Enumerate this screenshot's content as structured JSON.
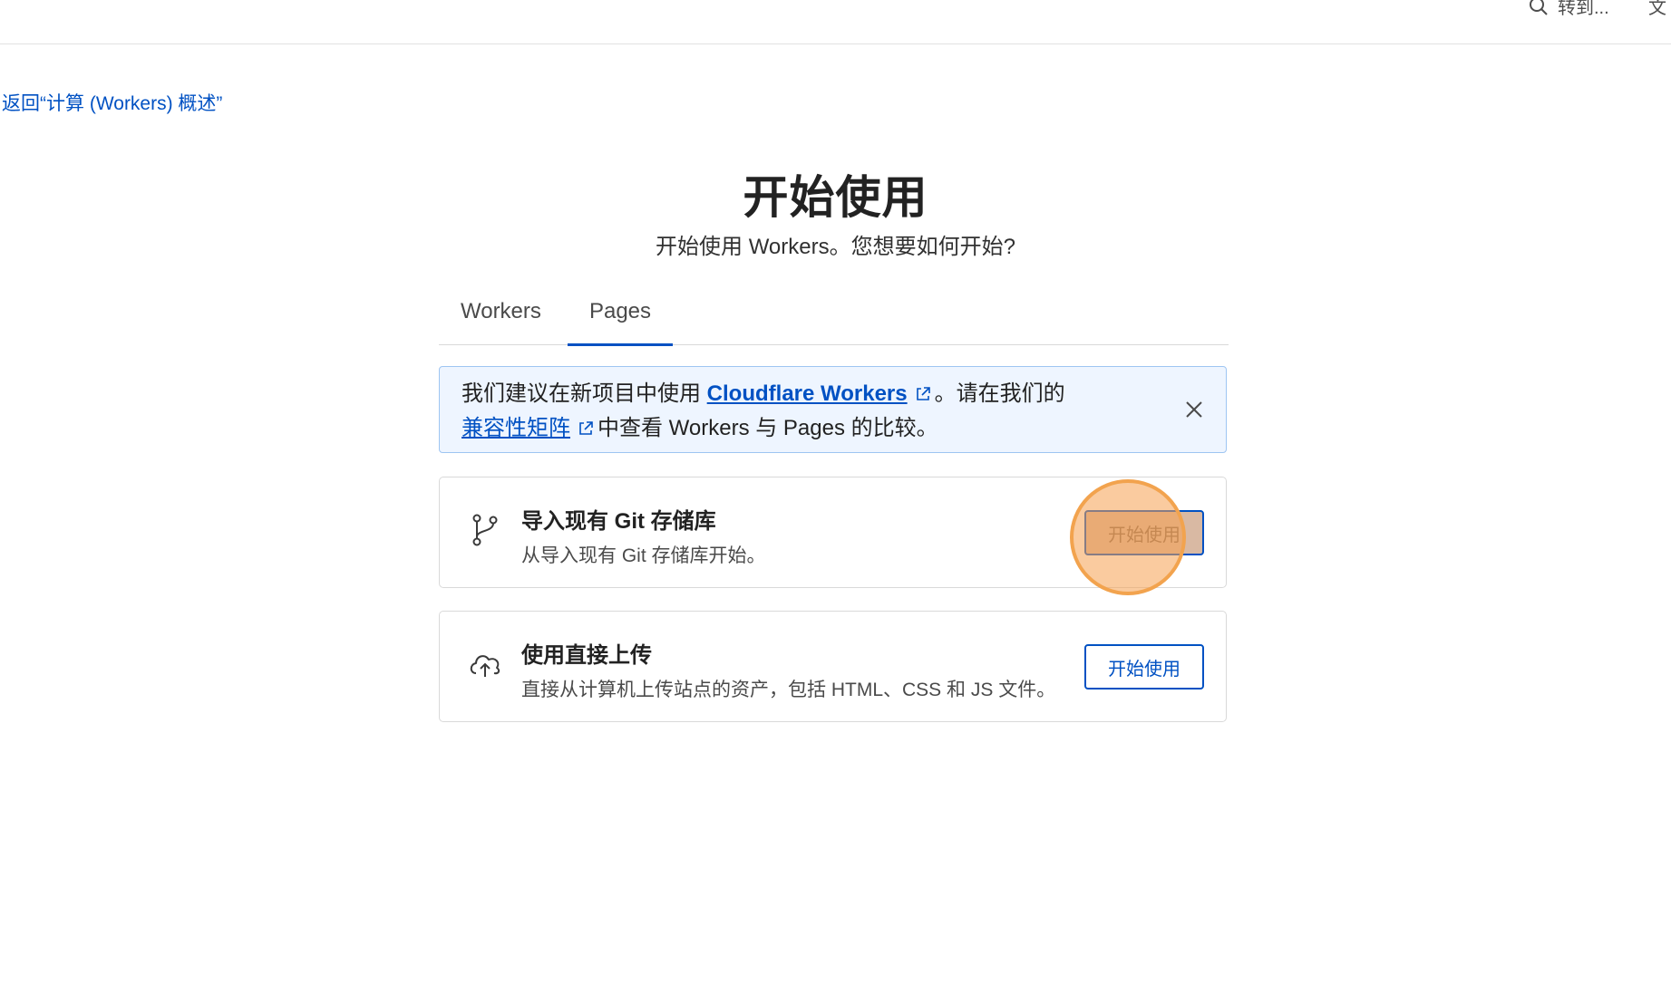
{
  "topbar": {
    "goto_label": "转到...",
    "edge_label": "文"
  },
  "back_link": "返回“计算 (Workers) 概述”",
  "page": {
    "title": "开始使用",
    "subtitle": "开始使用 Workers。您想要如何开始?"
  },
  "tabs": [
    {
      "label": "Workers",
      "active": false
    },
    {
      "label": "Pages",
      "active": true
    }
  ],
  "banner": {
    "text_1": "我们建议在新项目中使用",
    "link_1": "Cloudflare Workers",
    "text_2": "。请在我们的",
    "link_2": "兼容性矩阵",
    "text_3": "中查看 Workers 与 Pages 的比较。"
  },
  "cards": [
    {
      "icon": "git-branch-icon",
      "title": "导入现有 Git 存储库",
      "description": "从导入现有 Git 存储库开始。",
      "button": "开始使用"
    },
    {
      "icon": "cloud-upload-icon",
      "title": "使用直接上传",
      "description": "直接从计算机上传站点的资产，包括 HTML、CSS 和 JS 文件。",
      "button": "开始使用"
    }
  ],
  "colors": {
    "accent": "#0051c3",
    "banner_bg": "#eef5ff",
    "click_highlight": "#f6a050"
  }
}
